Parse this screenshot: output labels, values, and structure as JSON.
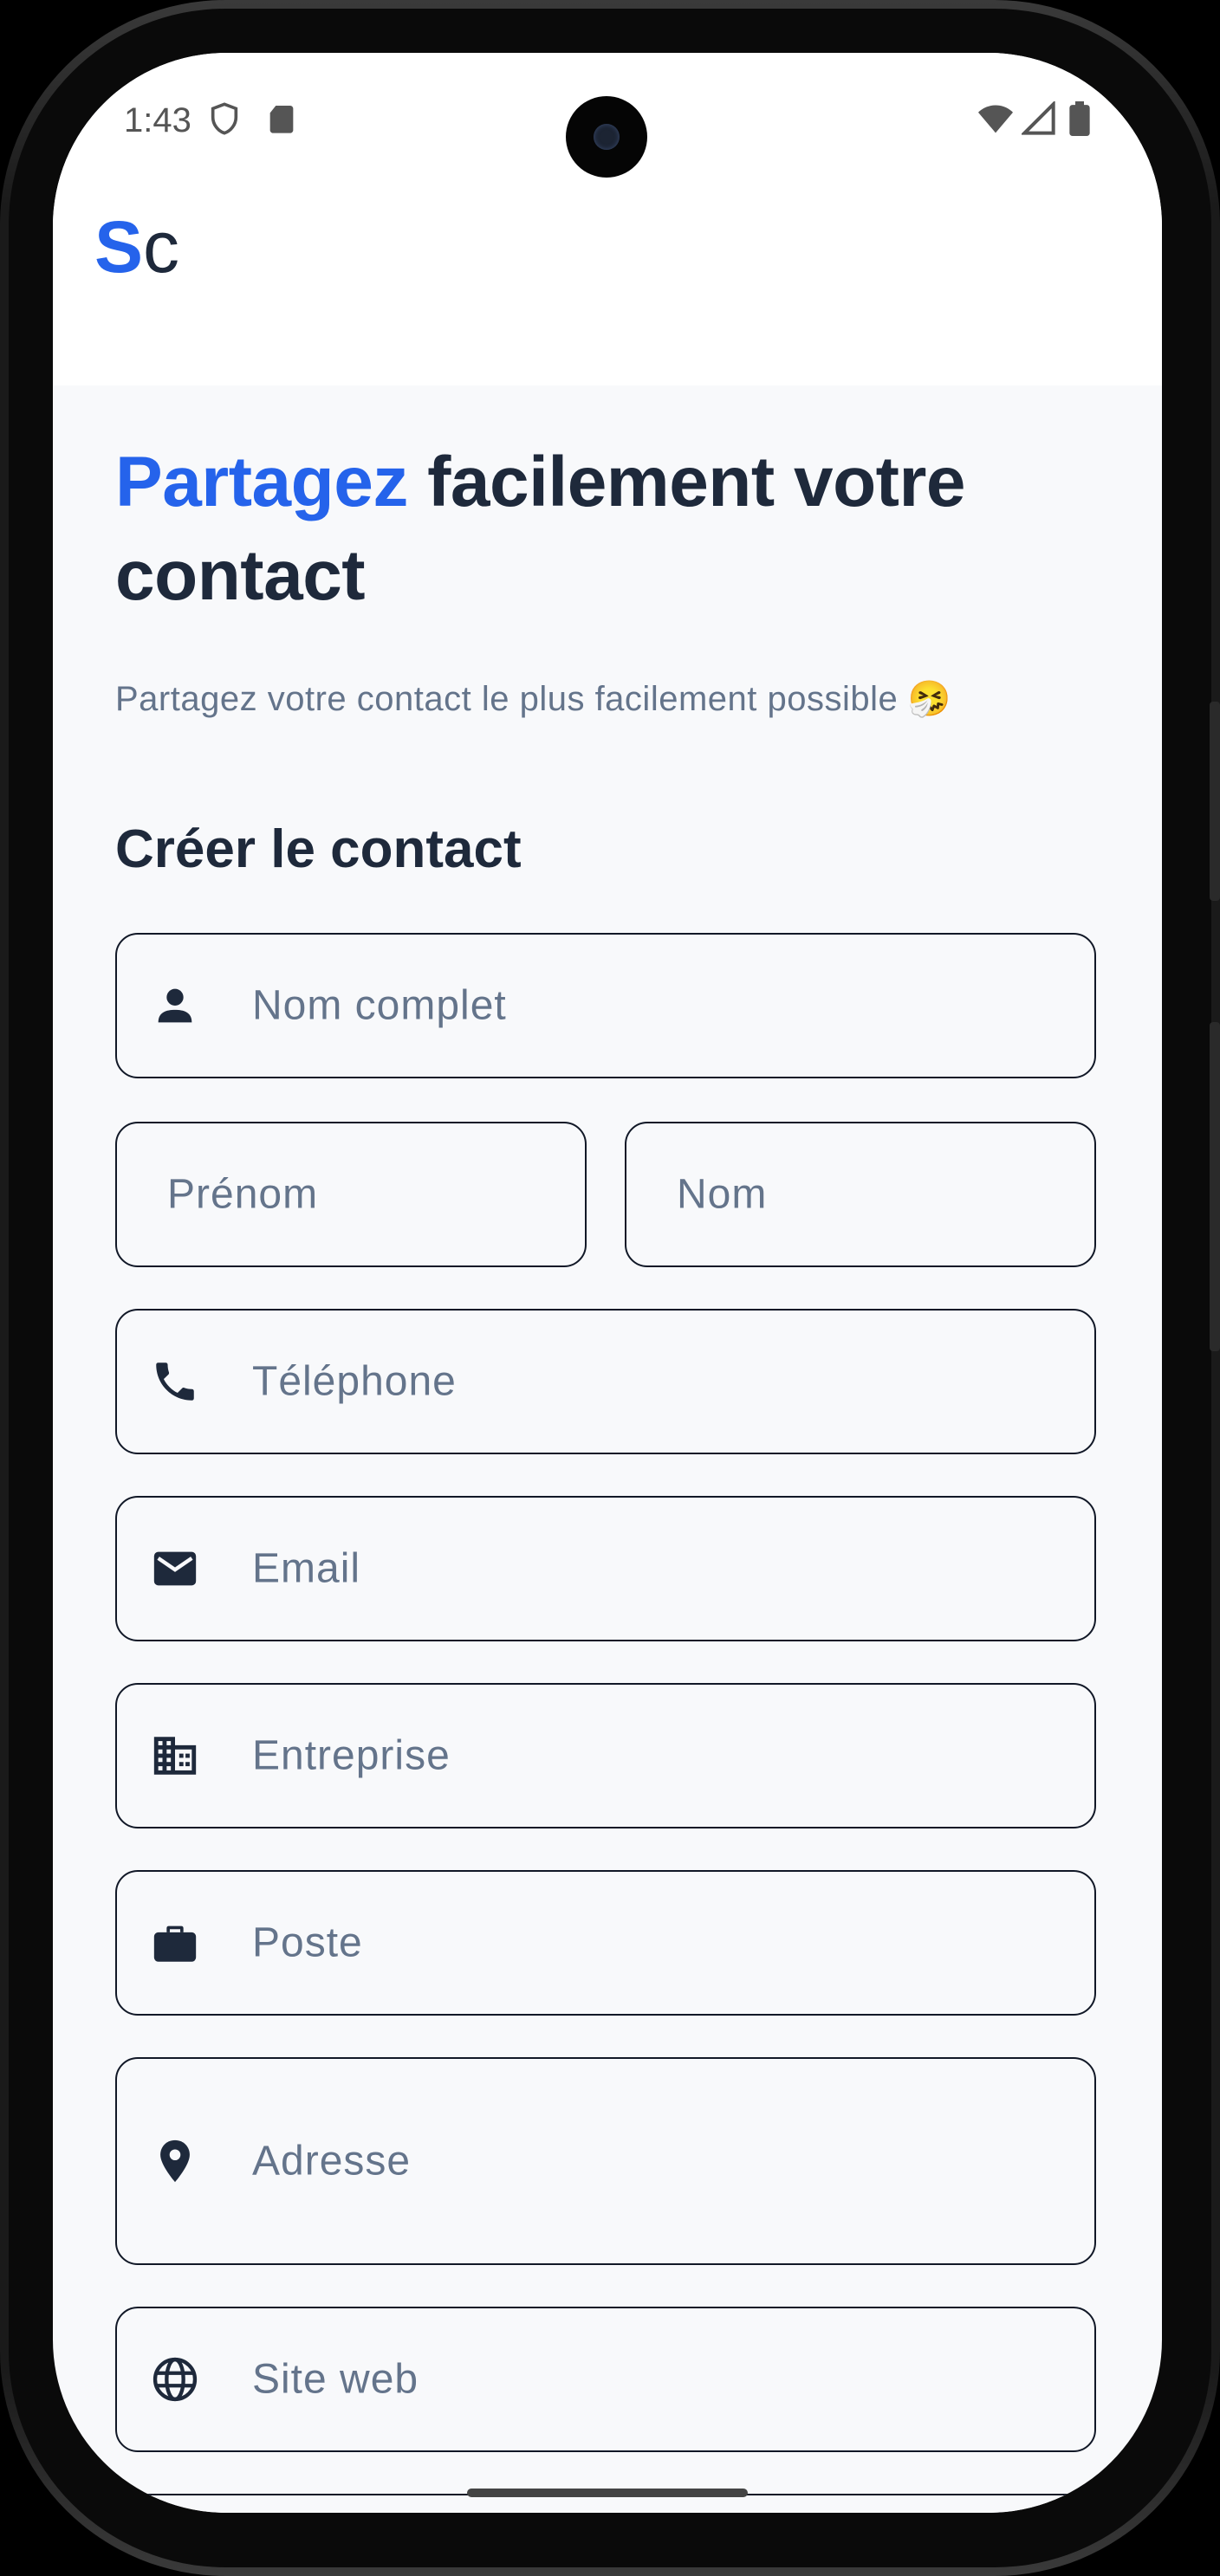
{
  "status_bar": {
    "time": "1:43"
  },
  "app": {
    "logo_first": "S",
    "logo_second": "c"
  },
  "hero": {
    "title_accent": "Partagez",
    "title_rest": " facilement votre contact",
    "subtitle": "Partagez votre contact le plus facilement possible 🤧"
  },
  "form": {
    "section_title": "Créer le contact",
    "full_name_placeholder": "Nom complet",
    "first_name_placeholder": "Prénom",
    "last_name_placeholder": "Nom",
    "phone_placeholder": "Téléphone",
    "email_placeholder": "Email",
    "company_placeholder": "Entreprise",
    "position_placeholder": "Poste",
    "address_placeholder": "Adresse",
    "website_placeholder": "Site web"
  },
  "colors": {
    "accent": "#2563eb",
    "text_dark": "#1e293b",
    "text_muted": "#64748b",
    "background": "#f8f9fb"
  },
  "icons": [
    "shield-icon",
    "sd-card-icon",
    "wifi-icon",
    "signal-icon",
    "battery-icon",
    "person-icon",
    "phone-icon",
    "mail-icon",
    "building-icon",
    "briefcase-icon",
    "location-pin-icon",
    "globe-icon"
  ]
}
